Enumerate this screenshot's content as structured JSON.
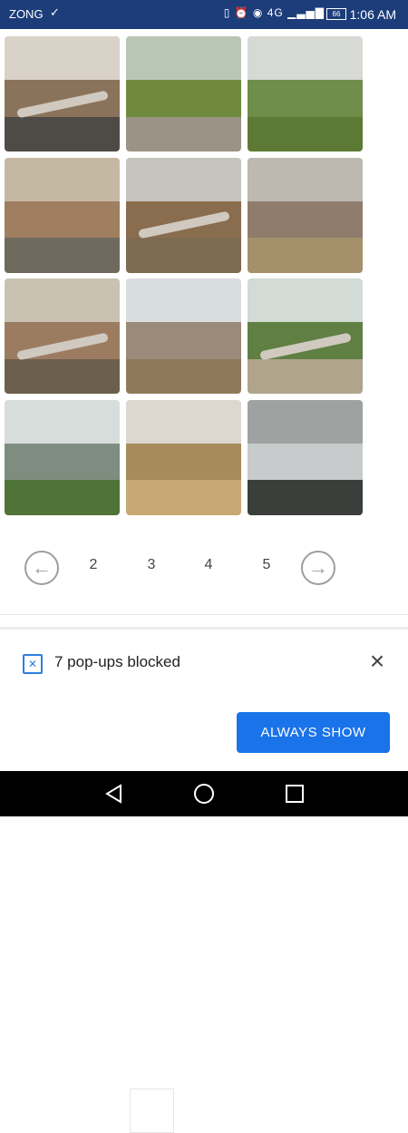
{
  "status_bar": {
    "carrier": "ZONG",
    "check_icon": "check-icon",
    "signal_text": "4G",
    "battery": "66",
    "time": "1:06 AM"
  },
  "gallery": {
    "images": [
      {
        "name": "mountain-road-image",
        "sky": "#d9d2c8",
        "mid": "#8a735b",
        "ground": "#4e4a46"
      },
      {
        "name": "green-hills-image",
        "sky": "#b9c6b4",
        "mid": "#6f8a3c",
        "ground": "#9b9486"
      },
      {
        "name": "hill-village-image",
        "sky": "#d7d9d5",
        "mid": "#6f8d4b",
        "ground": "#5d7a34"
      },
      {
        "name": "rock-tower-image",
        "sky": "#c5b8a2",
        "mid": "#9f7f60",
        "ground": "#6f6a5e"
      },
      {
        "name": "winding-road-image",
        "sky": "#c7c4bf",
        "mid": "#8a6c4e",
        "ground": "#7d6b52"
      },
      {
        "name": "cliff-road-image",
        "sky": "#bdb8b0",
        "mid": "#8f7c6c",
        "ground": "#a4916c"
      },
      {
        "name": "bridge-loop-image",
        "sky": "#c9c2b3",
        "mid": "#9c7c61",
        "ground": "#6c5f4d"
      },
      {
        "name": "swing-park-image",
        "sky": "#d8ddde",
        "mid": "#9a8a7a",
        "ground": "#8e7a5a"
      },
      {
        "name": "valley-truck-image",
        "sky": "#d2dbd5",
        "mid": "#5f7f43",
        "ground": "#b0a48c"
      },
      {
        "name": "lake-view-image",
        "sky": "#d7ddda",
        "mid": "#7f8d80",
        "ground": "#4f7338"
      },
      {
        "name": "desert-hill-image",
        "sky": "#dcd8cf",
        "mid": "#a78b5a",
        "ground": "#c7a874"
      },
      {
        "name": "misty-mountain-image",
        "sky": "#9ea3a2",
        "mid": "#c7cbcb",
        "ground": "#3b3f3c"
      }
    ]
  },
  "pager": {
    "prev_icon": "arrow-left-icon",
    "pages": [
      "2",
      "3",
      "4",
      "5"
    ],
    "current": "3",
    "next_icon": "arrow-right-icon"
  },
  "popup": {
    "icon": "popup-blocked-icon",
    "message": "7 pop-ups blocked",
    "close_icon": "close-icon",
    "button_label": "ALWAYS SHOW",
    "button_color": "#1a73e8"
  },
  "nav_bar": {
    "back_icon": "back-triangle-icon",
    "home_icon": "home-circle-icon",
    "recent_icon": "recent-square-icon"
  }
}
